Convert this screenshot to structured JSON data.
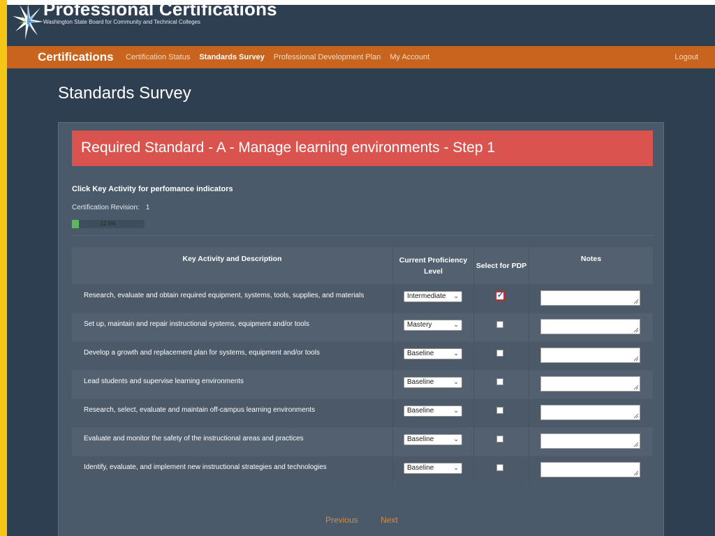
{
  "site": {
    "title": "Professional Certifications",
    "subtitle": "Washington State Board for Community and Technical Colleges"
  },
  "nav": {
    "brand": "Certifications",
    "links": [
      {
        "label": "Certification Status",
        "active": false
      },
      {
        "label": "Standards Survey",
        "active": true
      },
      {
        "label": "Professional Development Plan",
        "active": false
      },
      {
        "label": "My Account",
        "active": false
      }
    ],
    "logout": "Logout"
  },
  "page": {
    "title": "Standards Survey"
  },
  "survey": {
    "banner": "Required Standard - A - Manage learning environments - Step 1",
    "instructions": "Click Key Activity for perfomance indicators",
    "revision_label": "Certification Revision:",
    "revision_value": "1",
    "progress_percent": 12.5,
    "progress_label": "12.5%"
  },
  "table": {
    "headers": {
      "activity": "Key Activity and Description",
      "proficiency": "Current Proficiency Level",
      "select": "Select for PDP",
      "notes": "Notes"
    },
    "rows": [
      {
        "activity": "Research, evaluate and obtain required equipment, systems, tools, supplies, and materials",
        "level": "Intermediate",
        "selected": true,
        "notes": ""
      },
      {
        "activity": "Set up, maintain and repair instructional systems, equipment and/or tools",
        "level": "Mastery",
        "selected": false,
        "notes": ""
      },
      {
        "activity": "Develop a growth and replacement plan for systems, equipment and/or tools",
        "level": "Baseline",
        "selected": false,
        "notes": ""
      },
      {
        "activity": "Lead students and supervise learning environments",
        "level": "Baseline",
        "selected": false,
        "notes": ""
      },
      {
        "activity": "Research, select, evaluate and maintain off-campus learning environments",
        "level": "Baseline",
        "selected": false,
        "notes": ""
      },
      {
        "activity": "Evaluate and monitor the safety of the instructional areas and practices",
        "level": "Baseline",
        "selected": false,
        "notes": ""
      },
      {
        "activity": "Identify, evaluate, and implement new instructional strategies and technologies",
        "level": "Baseline",
        "selected": false,
        "notes": ""
      }
    ]
  },
  "pager": {
    "previous": "Previous",
    "next": "Next"
  },
  "colors": {
    "background": "#2e3f52",
    "nav": "#c8641e",
    "banner": "#d9534f",
    "progress": "#5cb85c",
    "pager_link": "#d88a3a",
    "left_accent": "#f5c518"
  },
  "icons": {
    "logo": "starburst-logo-icon",
    "dropdown": "chevron-down-icon",
    "check": "checkmark-icon",
    "resize": "resize-grip-icon"
  }
}
